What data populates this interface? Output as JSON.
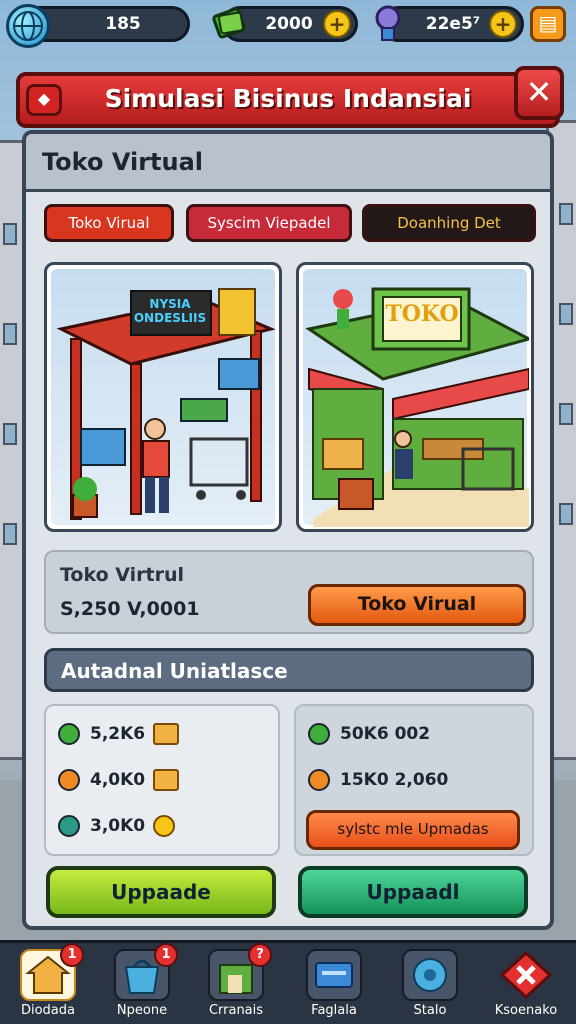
{
  "topbar": {
    "globe_value": "185",
    "cash_value": "2000",
    "gem_value": "22e5⁷",
    "icons": [
      "globe-icon",
      "cash-icon",
      "gem-icon",
      "plus-icon",
      "menu-icon"
    ]
  },
  "banner": {
    "title": "Simulasi Bisinus Indansiai",
    "close_label": "✕"
  },
  "panel": {
    "title": "Toko Virtual",
    "tabs": [
      {
        "label": "Toko Virual",
        "color": "#d9361f"
      },
      {
        "label": "Syscim Viepadel",
        "color": "#c72b3a"
      },
      {
        "label": "Doanhing Det",
        "color": "#231818"
      }
    ],
    "cards": [
      {
        "sign": "NYSIA ONDESLIIS"
      },
      {
        "sign": "TOKO"
      }
    ],
    "info": {
      "name": "Toko Virtrul",
      "price": "S,250 V,0001",
      "button": "Toko Virual"
    },
    "section_title": "Autadnal Uniatlasce",
    "stats_left": [
      {
        "value": "5,2K6",
        "color": "#3fae3a"
      },
      {
        "value": "4,0K0",
        "color": "#f08a24"
      },
      {
        "value": "3,0K0",
        "color": "#2a9a86"
      }
    ],
    "stats_right": [
      {
        "value": "50K6 002",
        "color": "#3fae3a"
      },
      {
        "value": "15K0 2,060",
        "color": "#f08a24"
      }
    ],
    "stats_right_button": "sylstc mle Upmadas",
    "upgrade_left": "Uppaade",
    "upgrade_right": "Uppaadl"
  },
  "nav": [
    {
      "label": "Diodada",
      "badge": "1",
      "icon": "home-icon"
    },
    {
      "label": "Npeone",
      "badge": "1",
      "icon": "basket-icon"
    },
    {
      "label": "Crranais",
      "badge": "?",
      "icon": "shop-icon"
    },
    {
      "label": "Faglala",
      "badge": "",
      "icon": "card-icon"
    },
    {
      "label": "Stalo",
      "badge": "",
      "icon": "globe-icon"
    },
    {
      "label": "Ksoenako",
      "badge": "",
      "icon": "close-icon"
    }
  ]
}
